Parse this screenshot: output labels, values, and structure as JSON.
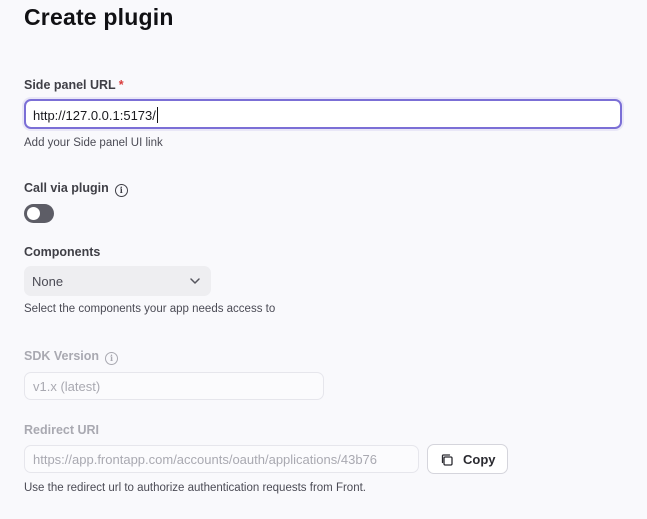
{
  "page": {
    "title": "Create plugin"
  },
  "side_panel": {
    "label": "Side panel URL",
    "required_mark": "*",
    "value": "http://127.0.0.1:5173/",
    "help": "Add your Side panel UI link"
  },
  "call_via_plugin": {
    "label": "Call via plugin",
    "info_icon": "info-icon",
    "enabled": false
  },
  "components": {
    "label": "Components",
    "selected": "None",
    "help": "Select the components your app needs access to"
  },
  "sdk_version": {
    "label": "SDK Version",
    "info_icon": "info-icon",
    "placeholder": "v1.x (latest)"
  },
  "redirect_uri": {
    "label": "Redirect URI",
    "value": "https://app.frontapp.com/accounts/oauth/applications/43b76",
    "copy_label": "Copy",
    "help": "Use the redirect url to authorize authentication requests from Front."
  },
  "colors": {
    "accent": "#7b6fd6",
    "required": "#d93b3b",
    "toggle_off": "#5d5d66"
  }
}
